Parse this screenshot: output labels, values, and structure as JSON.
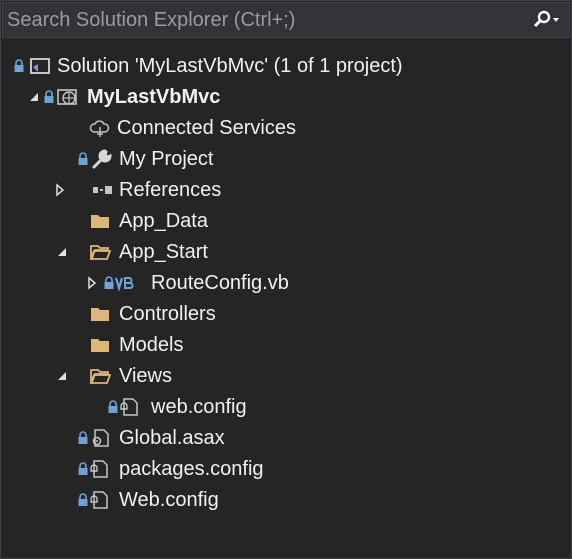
{
  "search": {
    "placeholder": "Search Solution Explorer (Ctrl+;)"
  },
  "tree": {
    "solution_label": "Solution 'MyLastVbMvc' (1 of 1 project)",
    "project_label": "MyLastVbMvc",
    "connected_services_label": "Connected Services",
    "my_project_label": "My Project",
    "references_label": "References",
    "app_data_label": "App_Data",
    "app_start_label": "App_Start",
    "route_config_label": "RouteConfig.vb",
    "controllers_label": "Controllers",
    "models_label": "Models",
    "views_label": "Views",
    "views_web_config_label": "web.config",
    "global_asax_label": "Global.asax",
    "packages_config_label": "packages.config",
    "web_config_label": "Web.config"
  },
  "icons": {
    "solution": "solution-icon",
    "project": "web-project-icon",
    "connected_services": "connected-services-icon",
    "my_project": "wrench-icon",
    "references": "references-icon",
    "folder": "folder-icon",
    "folder_open": "folder-open-icon",
    "vb_file": "vb-file-icon",
    "config_file": "config-file-icon",
    "asax_file": "asax-file-icon",
    "search": "search-icon"
  },
  "colors": {
    "background": "#252526",
    "text": "#f1f1f1",
    "folder": "#dcb67a",
    "lock": "#6fa3d8",
    "vb": "#6fa3d8"
  }
}
